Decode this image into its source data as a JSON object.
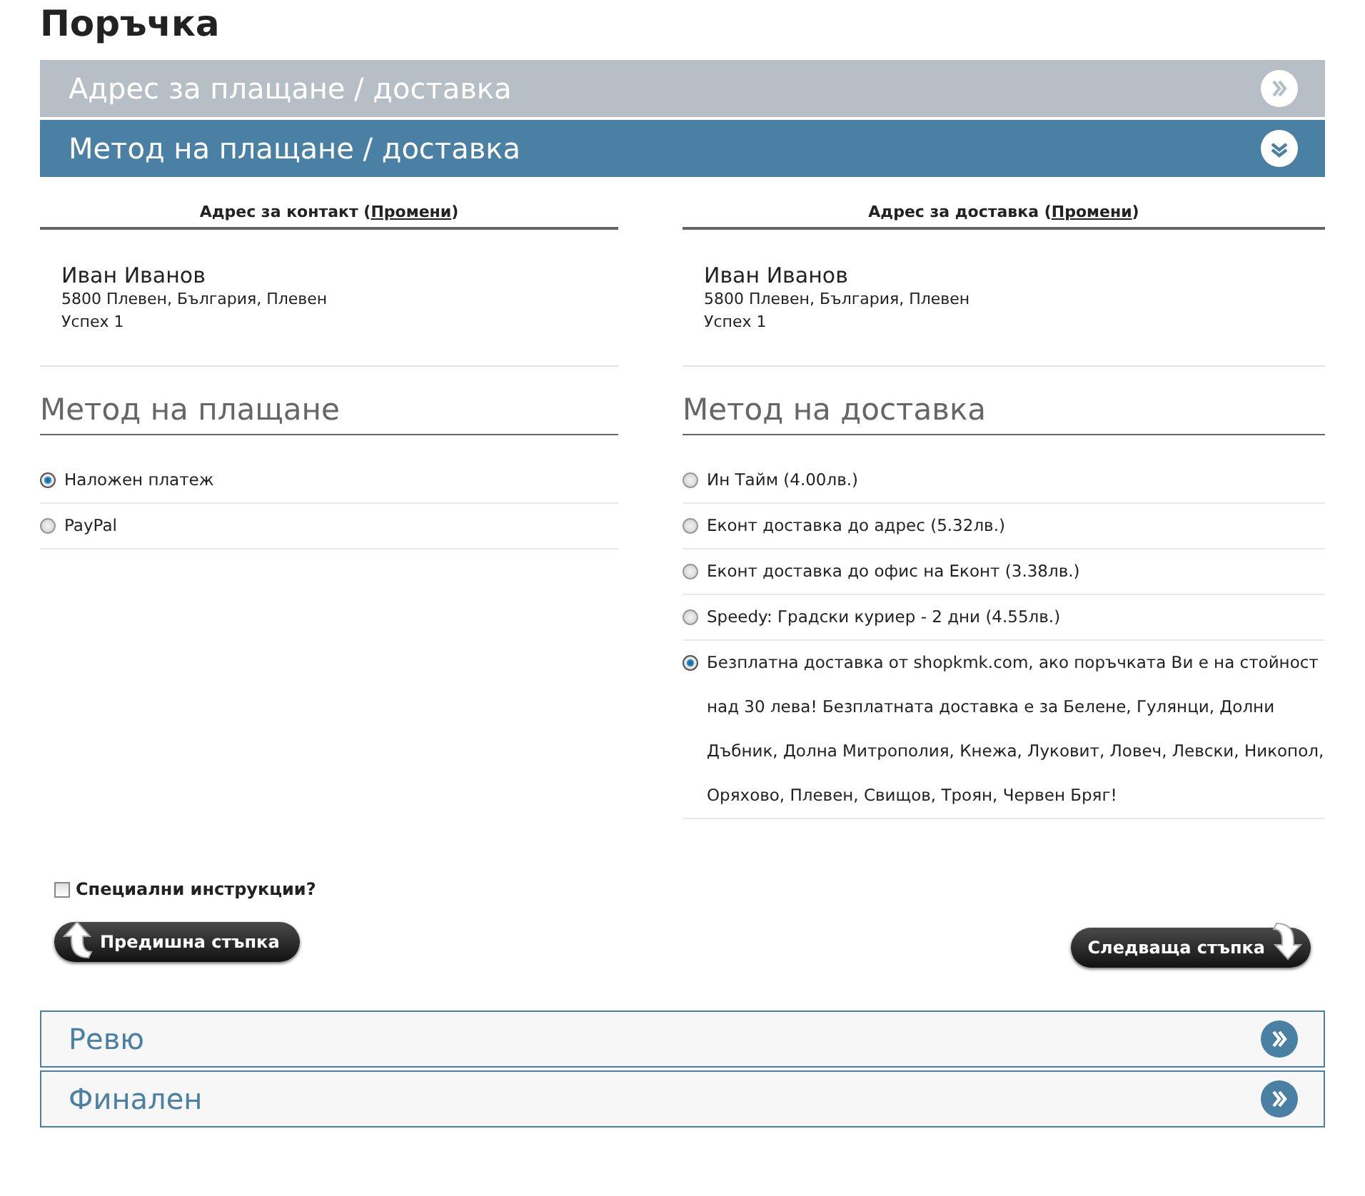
{
  "page_title": "Поръчка",
  "steps_top": [
    {
      "title": "Адрес за плащане / доставка",
      "kind": "completed",
      "expanded": false
    },
    {
      "title": "Метод на плащане / доставка",
      "kind": "current",
      "expanded": true
    }
  ],
  "addresses": [
    {
      "heading": "Адрес за контакт (",
      "link": "Промени",
      "heading_end": ")",
      "name": "Иван Иванов",
      "lines": [
        "5800 Плевен, България, Плевен",
        "Успех 1"
      ]
    },
    {
      "heading": "Адрес за доставка (",
      "link": "Промени",
      "heading_end": ")",
      "name": "Иван Иванов",
      "lines": [
        "5800 Плевен, България, Плевен",
        "Успех 1"
      ]
    }
  ],
  "payment": {
    "title": "Метод на плащане",
    "options": [
      {
        "label": "Наложен платеж",
        "selected": true
      },
      {
        "label": "PayPal",
        "selected": false
      }
    ]
  },
  "shipping": {
    "title": "Метод на доставка",
    "options": [
      {
        "label": "Ин Тайм (4.00лв.)",
        "selected": false
      },
      {
        "label": "Еконт доставка до адрес (5.32лв.)",
        "selected": false
      },
      {
        "label": "Еконт доставка до офис на Еконт (3.38лв.)",
        "selected": false
      },
      {
        "label": "Speedy: Градски куриер - 2 дни (4.55лв.)",
        "selected": false
      },
      {
        "label": "Безплатна доставка от shopkmk.com, ако поръчката Ви е на стойност над 30 лева! Безплатната доставка е за Белене, Гулянци, Долни Дъбник, Долна Митрополия, Кнежа, Луковит, Ловеч, Левски, Никопол, Оряхово, Плевен, Свищов, Троян, Червен Бряг!",
        "selected": true
      }
    ]
  },
  "special_instructions": {
    "label": "Специални инструкции?",
    "checked": false
  },
  "buttons": [
    {
      "label": "Предишна стъпка",
      "kind": "back"
    },
    {
      "label": "Следваща стъпка",
      "kind": "next"
    }
  ],
  "steps_bottom": [
    {
      "title": "Ревю",
      "kind": "upcoming",
      "expanded": false
    },
    {
      "title": "Финален",
      "kind": "upcoming",
      "expanded": false
    }
  ]
}
